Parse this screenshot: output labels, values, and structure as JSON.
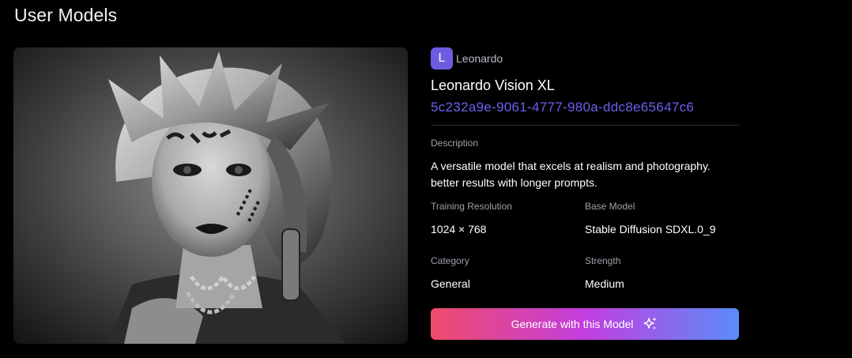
{
  "page": {
    "title": "User Models"
  },
  "preview": {
    "alt": "Black and white portrait of a punk woman with spiky hair, face tattoos and chains"
  },
  "model": {
    "owner_initial": "L",
    "owner_name": "Leonardo",
    "name": "Leonardo Vision XL",
    "id": "5c232a9e-9061-4777-980a-ddc8e65647c6",
    "description_label": "Description",
    "description": "A versatile model that excels at realism and photography. better results with longer prompts.",
    "training_resolution_label": "Training Resolution",
    "training_resolution": "1024 × 768",
    "base_model_label": "Base Model",
    "base_model": "Stable Diffusion SDXL.0_9",
    "category_label": "Category",
    "category": "General",
    "strength_label": "Strength",
    "strength": "Medium"
  },
  "actions": {
    "generate_label": "Generate with this Model",
    "generate_icon": "sparkles-icon"
  },
  "colors": {
    "accent": "#6d5ff0",
    "avatar": "#6d5be0",
    "gradient_start": "#ef4b69",
    "gradient_end": "#5b8cf8"
  }
}
